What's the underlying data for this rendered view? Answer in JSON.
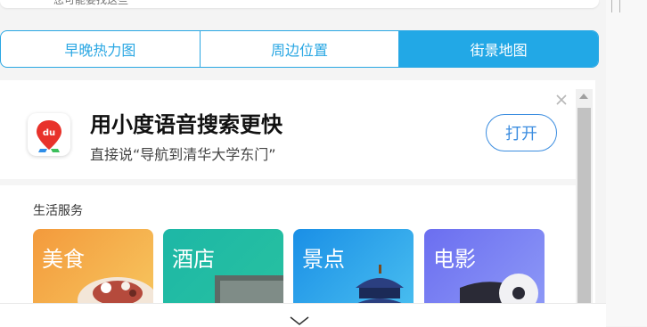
{
  "top_snippet": {
    "cut_text": "您可能要找这些"
  },
  "tabs": [
    {
      "label": "早晚热力图",
      "active": false
    },
    {
      "label": "周边位置",
      "active": false
    },
    {
      "label": "街景地图",
      "active": true
    }
  ],
  "promo": {
    "icon": "du-map-app-icon",
    "title": "用小度语音搜索更快",
    "subtitle": "直接说“导航到清华大学东门”",
    "open_label": "打开"
  },
  "services": {
    "title": "生活服务",
    "tiles": [
      {
        "label": "美食",
        "color": "#f2a24a"
      },
      {
        "label": "酒店",
        "color": "#22b8a3"
      },
      {
        "label": "景点",
        "color": "#2aa0ee"
      },
      {
        "label": "电影",
        "color": "#6b7ef2"
      }
    ]
  },
  "colors": {
    "accent": "#22a8e6",
    "button": "#3b8de0"
  }
}
